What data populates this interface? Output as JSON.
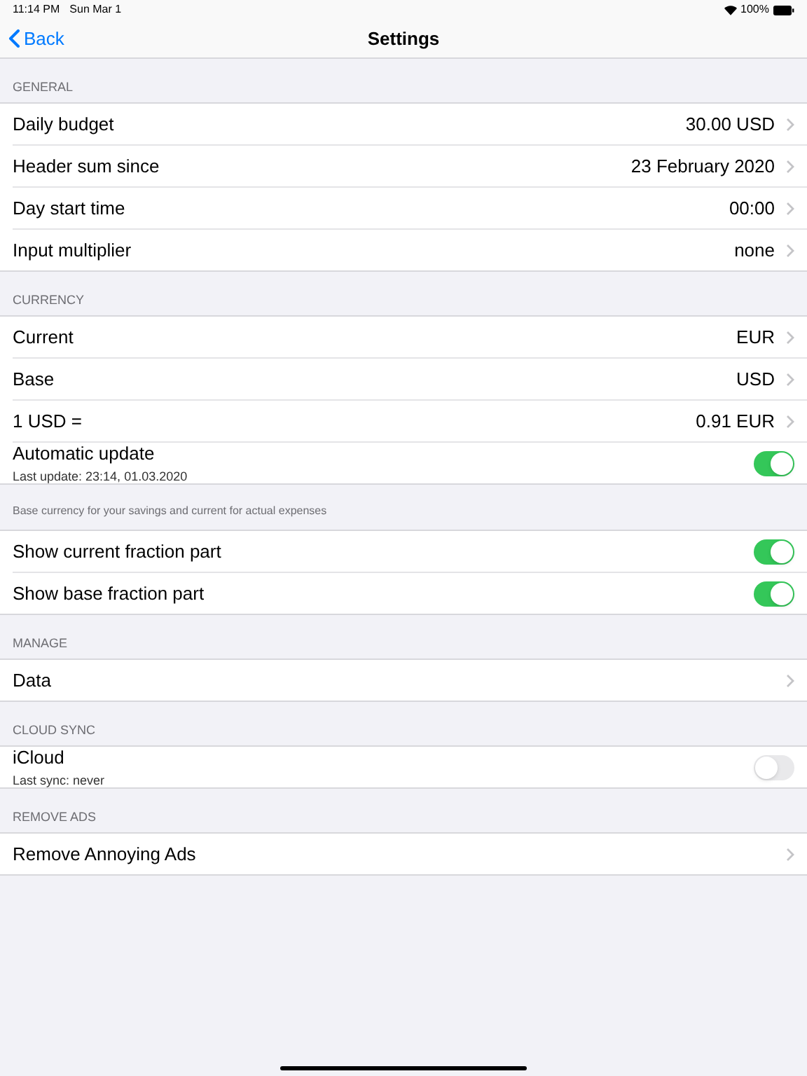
{
  "status_bar": {
    "time": "11:14 PM",
    "date": "Sun Mar 1",
    "battery": "100%"
  },
  "nav": {
    "back": "Back",
    "title": "Settings"
  },
  "sections": [
    {
      "header": "GENERAL",
      "rows": [
        {
          "kind": "link",
          "label": "Daily budget",
          "value": "30.00 USD"
        },
        {
          "kind": "link",
          "label": "Header sum since",
          "value": "23 February 2020"
        },
        {
          "kind": "link",
          "label": "Day start time",
          "value": "00:00"
        },
        {
          "kind": "link",
          "label": "Input multiplier",
          "value": "none"
        }
      ]
    },
    {
      "header": "CURRENCY",
      "footer": "Base currency for your savings and current for actual expenses",
      "rows": [
        {
          "kind": "link",
          "label": "Current",
          "value": "EUR"
        },
        {
          "kind": "link",
          "label": "Base",
          "value": "USD"
        },
        {
          "kind": "link",
          "label": "1 USD =",
          "value": "0.91 EUR"
        },
        {
          "kind": "toggle",
          "label": "Automatic update",
          "subtitle": "Last update: 23:14, 01.03.2020",
          "on": true
        }
      ]
    },
    {
      "rows": [
        {
          "kind": "toggle",
          "label": "Show current fraction part",
          "on": true
        },
        {
          "kind": "toggle",
          "label": "Show base fraction part",
          "on": true
        }
      ]
    },
    {
      "header": "MANAGE",
      "rows": [
        {
          "kind": "link",
          "label": "Data"
        }
      ]
    },
    {
      "header": "CLOUD SYNC",
      "rows": [
        {
          "kind": "toggle",
          "label": "iCloud",
          "subtitle": "Last sync: never",
          "on": false
        }
      ]
    },
    {
      "header": "REMOVE ADS",
      "rows": [
        {
          "kind": "link",
          "label": "Remove Annoying Ads"
        }
      ]
    }
  ]
}
